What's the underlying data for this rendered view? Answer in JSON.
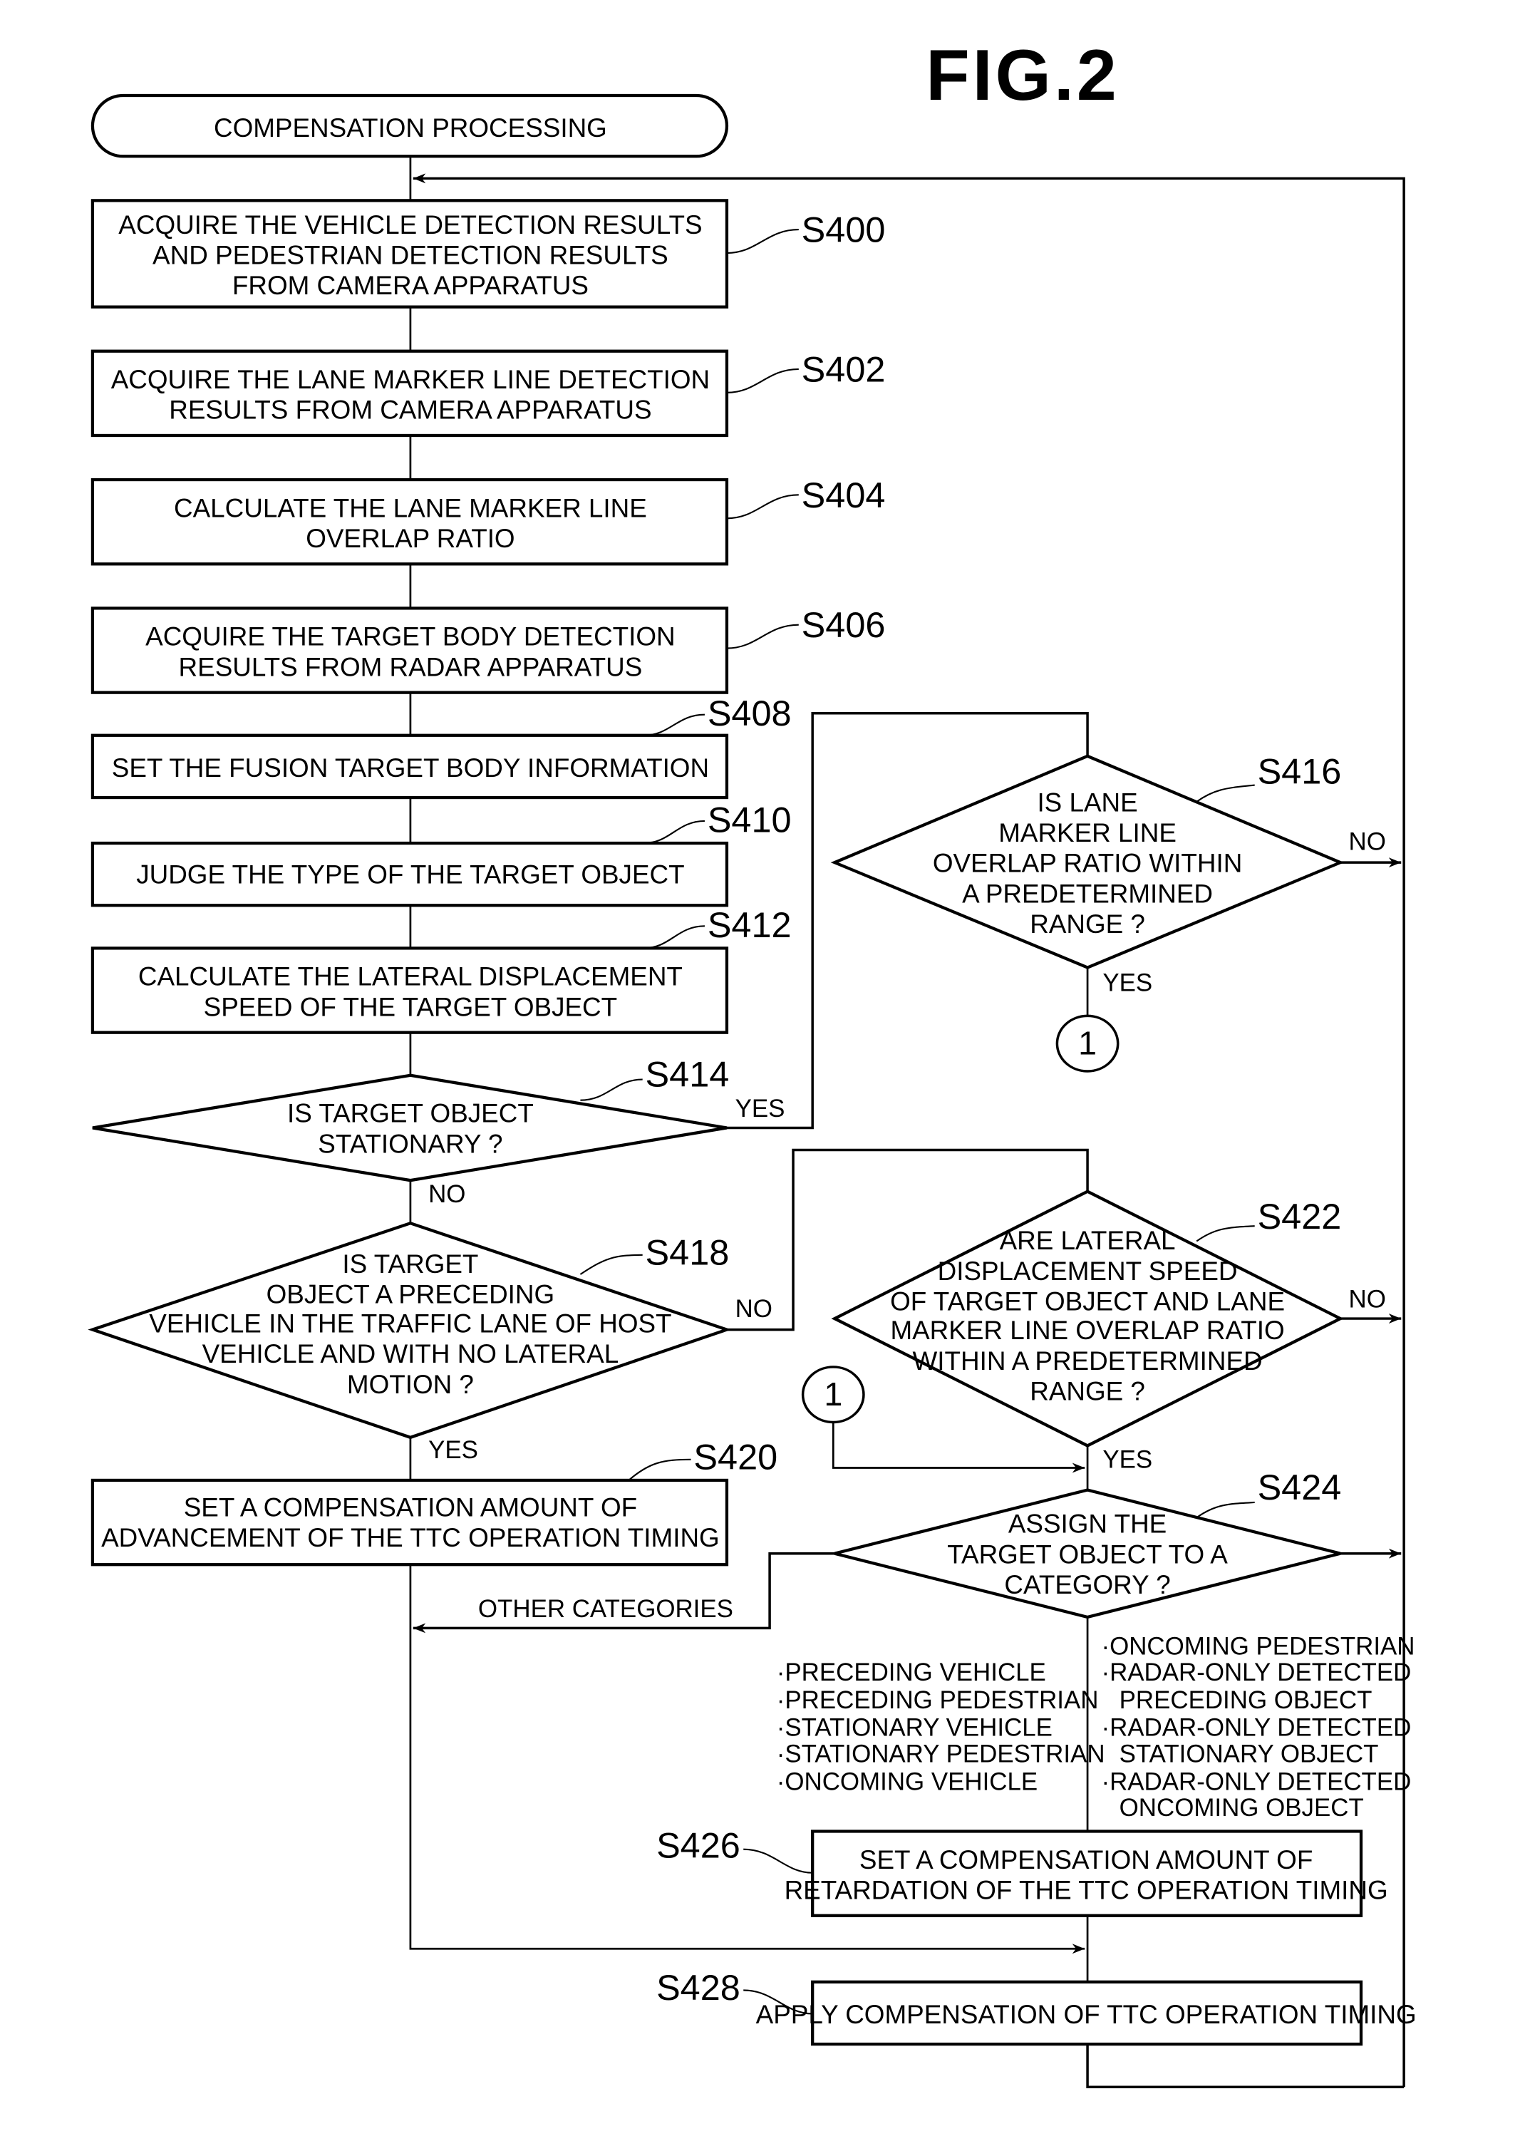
{
  "figure_title": "FIG.2",
  "start": {
    "label": "COMPENSATION PROCESSING"
  },
  "steps": {
    "S400": {
      "id": "S400",
      "lines": [
        "ACQUIRE THE VEHICLE DETECTION RESULTS",
        "AND PEDESTRIAN DETECTION RESULTS",
        "FROM CAMERA APPARATUS"
      ]
    },
    "S402": {
      "id": "S402",
      "lines": [
        "ACQUIRE THE LANE MARKER LINE DETECTION",
        "RESULTS FROM CAMERA APPARATUS"
      ]
    },
    "S404": {
      "id": "S404",
      "lines": [
        "CALCULATE THE LANE MARKER LINE",
        "OVERLAP RATIO"
      ]
    },
    "S406": {
      "id": "S406",
      "lines": [
        "ACQUIRE THE TARGET BODY DETECTION",
        "RESULTS FROM RADAR APPARATUS"
      ]
    },
    "S408": {
      "id": "S408",
      "lines": [
        "SET THE FUSION TARGET BODY INFORMATION"
      ]
    },
    "S410": {
      "id": "S410",
      "lines": [
        "JUDGE THE TYPE OF THE TARGET OBJECT"
      ]
    },
    "S412": {
      "id": "S412",
      "lines": [
        "CALCULATE THE LATERAL DISPLACEMENT",
        "SPEED OF THE TARGET OBJECT"
      ]
    },
    "S414": {
      "id": "S414",
      "lines": [
        "IS TARGET OBJECT",
        "STATIONARY ?"
      ]
    },
    "S416": {
      "id": "S416",
      "lines": [
        "IS LANE",
        "MARKER LINE",
        "OVERLAP RATIO WITHIN",
        "A PREDETERMINED",
        "RANGE ?"
      ]
    },
    "S418": {
      "id": "S418",
      "lines": [
        "IS TARGET",
        "OBJECT A PRECEDING",
        "VEHICLE IN THE TRAFFIC LANE OF HOST",
        "VEHICLE AND WITH NO LATERAL",
        "MOTION ?"
      ]
    },
    "S420": {
      "id": "S420",
      "lines": [
        "SET A COMPENSATION AMOUNT OF",
        "ADVANCEMENT OF THE TTC OPERATION TIMING"
      ]
    },
    "S422": {
      "id": "S422",
      "lines": [
        "ARE LATERAL",
        "DISPLACEMENT SPEED",
        "OF TARGET OBJECT AND LANE",
        "MARKER LINE OVERLAP RATIO",
        "WITHIN A PREDETERMINED",
        "RANGE ?"
      ]
    },
    "S424": {
      "id": "S424",
      "lines": [
        "ASSIGN THE",
        "TARGET OBJECT TO A",
        "CATEGORY ?"
      ]
    },
    "S426": {
      "id": "S426",
      "lines": [
        "SET A COMPENSATION AMOUNT OF",
        "RETARDATION OF THE TTC OPERATION TIMING"
      ]
    },
    "S428": {
      "id": "S428",
      "lines": [
        "APPLY COMPENSATION OF TTC OPERATION TIMING"
      ]
    }
  },
  "branch_labels": {
    "yes": "YES",
    "no": "NO",
    "other_categories": "OTHER CATEGORIES"
  },
  "connector_label": "1",
  "categories_left": [
    "·PRECEDING VEHICLE",
    "·PRECEDING PEDESTRIAN",
    "·STATIONARY VEHICLE",
    "·STATIONARY PEDESTRIAN",
    "·ONCOMING VEHICLE"
  ],
  "categories_right": [
    "·ONCOMING PEDESTRIAN",
    "·RADAR-ONLY DETECTED",
    " PRECEDING OBJECT",
    "·RADAR-ONLY DETECTED",
    " STATIONARY OBJECT",
    "·RADAR-ONLY DETECTED",
    " ONCOMING OBJECT"
  ]
}
